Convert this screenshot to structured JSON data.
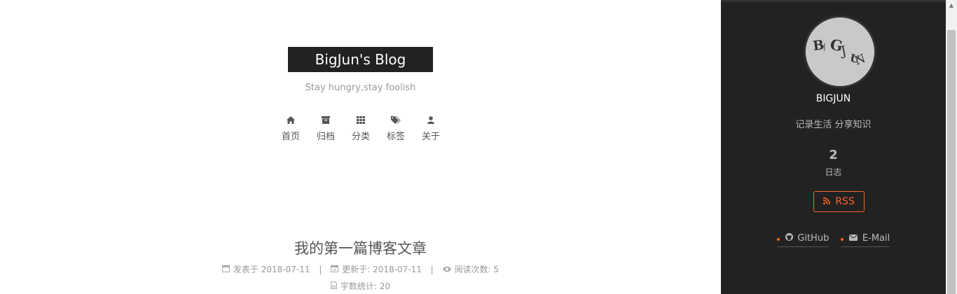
{
  "header": {
    "brand": "BigJun's Blog",
    "subtitle": "Stay hungry,stay foolish"
  },
  "menu": [
    {
      "label": "首页",
      "icon": "home-icon"
    },
    {
      "label": "归档",
      "icon": "archive-icon"
    },
    {
      "label": "分类",
      "icon": "th-icon"
    },
    {
      "label": "标签",
      "icon": "tags-icon"
    },
    {
      "label": "关于",
      "icon": "user-icon"
    }
  ],
  "post": {
    "title": "我的第一篇博客文章",
    "posted_label": "发表于",
    "posted_date": "2018-07-11",
    "updated_label": "更新于:",
    "updated_date": "2018-07-11",
    "views_label": "阅读次数:",
    "views": "5",
    "words_label": "字数统计:",
    "words": "20"
  },
  "sidebar": {
    "avatar_text": "BIGJUN",
    "author": "BIGJUN",
    "description": "记录生活 分享知识",
    "posts_count": "2",
    "posts_label": "日志",
    "rss_label": "RSS",
    "links": [
      {
        "label": "GitHub",
        "icon": "github-icon"
      },
      {
        "label": "E-Mail",
        "icon": "envelope-icon"
      }
    ]
  },
  "colors": {
    "accent": "#fc6423",
    "sidebar_bg": "#222222",
    "brand_bg": "#222222"
  }
}
